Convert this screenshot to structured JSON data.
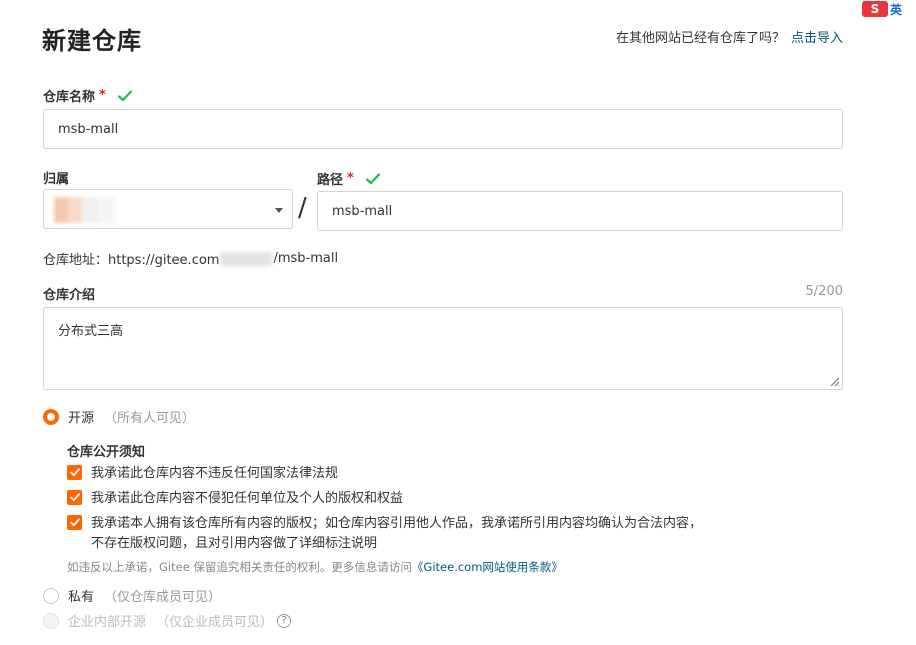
{
  "header": {
    "title": "新建仓库",
    "import_prompt": "在其他网站已经有仓库了吗？",
    "import_link": "点击导入"
  },
  "ime": {
    "logo": "S",
    "mode": "英"
  },
  "repo_name": {
    "label": "仓库名称",
    "required_mark": "*",
    "value": "msb-mall"
  },
  "owner": {
    "label": "归属"
  },
  "path": {
    "label": "路径",
    "required_mark": "*",
    "value": "msb-mall",
    "separator": "/"
  },
  "address": {
    "prefix": "仓库地址：https://gitee.com",
    "suffix": "/msb-mall"
  },
  "intro": {
    "label": "仓库介绍",
    "count": "5/200",
    "value": "分布式三高"
  },
  "visibility": {
    "open": {
      "label": "开源",
      "hint": "（所有人可见）"
    },
    "private": {
      "label": "私有",
      "hint": "（仅仓库成员可见）"
    },
    "enterprise": {
      "label": "企业内部开源",
      "hint": "（仅企业成员可见）",
      "help": "?"
    }
  },
  "notice": {
    "title": "仓库公开须知",
    "items": [
      "我承诺此仓库内容不违反任何国家法律法规",
      "我承诺此仓库内容不侵犯任何单位及个人的版权和权益"
    ],
    "item3_line1": "我承诺本人拥有该仓库所有内容的版权；如仓库内容引用他人作品，我承诺所引用内容均确认为合法内容，",
    "item3_line2": "不存在版权问题，且对引用内容做了详细标注说明"
  },
  "terms": {
    "text": "如违反以上承诺，Gitee 保留追究相关责任的权利。更多信息请访问",
    "link": "《Gitee.com网站使用条款》"
  },
  "colors": {
    "accent": "#ff6600",
    "check_green": "#21ba45",
    "link": "#005980",
    "required": "#db2828"
  }
}
